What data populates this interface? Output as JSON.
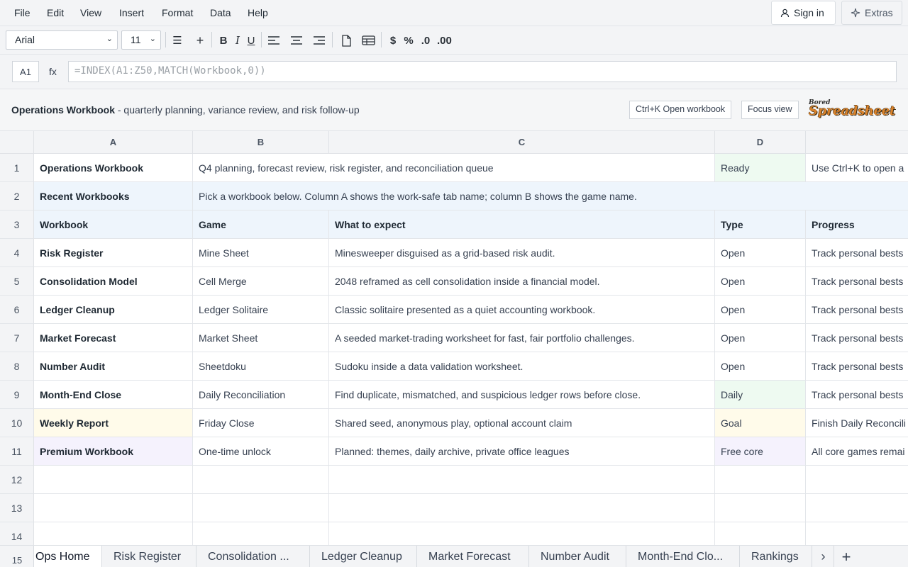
{
  "menu": [
    "File",
    "Edit",
    "View",
    "Insert",
    "Format",
    "Data",
    "Help"
  ],
  "top_buttons": {
    "sign_in": "Sign in",
    "extras": "Extras"
  },
  "toolbar": {
    "font_family": "Arial",
    "font_size": "11",
    "buttons": [
      "☰",
      "+",
      "B",
      "I",
      "U",
      "$",
      "%",
      ".0",
      ".00"
    ]
  },
  "formula_bar": {
    "cell_ref": "A1",
    "fx_label": "fx",
    "formula": "=INDEX(A1:Z50,MATCH(Workbook,0))"
  },
  "title_strip": {
    "title": "Operations Workbook",
    "subtitle": " - quarterly planning, variance review, and risk follow-up",
    "open_button": "Ctrl+K Open workbook",
    "focus_button": "Focus view",
    "logo_small": "Bored",
    "logo_big": "Spreadsheet"
  },
  "columns": [
    "A",
    "B",
    "C",
    "D",
    ""
  ],
  "rows": [
    {
      "num": "1",
      "cells": [
        "Operations Workbook",
        "Q4 planning, forecast review, risk register, and reconciliation queue",
        "",
        "Ready",
        "Use Ctrl+K to open a"
      ]
    },
    {
      "num": "2",
      "cells": [
        "Recent Workbooks",
        "Pick a workbook below. Column A shows the work-safe tab name; column B shows the game name."
      ]
    },
    {
      "num": "3",
      "cells": [
        "Workbook",
        "Game",
        "What to expect",
        "Type",
        "Progress"
      ]
    },
    {
      "num": "4",
      "cells": [
        "Risk Register",
        "Mine Sheet",
        "Minesweeper disguised as a grid-based risk audit.",
        "Open",
        "Track personal bests"
      ]
    },
    {
      "num": "5",
      "cells": [
        "Consolidation Model",
        "Cell Merge",
        "2048 reframed as cell consolidation inside a financial model.",
        "Open",
        "Track personal bests"
      ]
    },
    {
      "num": "6",
      "cells": [
        "Ledger Cleanup",
        "Ledger Solitaire",
        "Classic solitaire presented as a quiet accounting workbook.",
        "Open",
        "Track personal bests"
      ]
    },
    {
      "num": "7",
      "cells": [
        "Market Forecast",
        "Market Sheet",
        "A seeded market-trading worksheet for fast, fair portfolio challenges.",
        "Open",
        "Track personal bests"
      ]
    },
    {
      "num": "8",
      "cells": [
        "Number Audit",
        "Sheetdoku",
        "Sudoku inside a data validation worksheet.",
        "Open",
        "Track personal bests"
      ]
    },
    {
      "num": "9",
      "cells": [
        "Month-End Close",
        "Daily Reconciliation",
        "Find duplicate, mismatched, and suspicious ledger rows before close.",
        "Daily",
        "Track personal bests"
      ]
    },
    {
      "num": "10",
      "cells": [
        "Weekly Report",
        "Friday Close",
        "Shared seed, anonymous play, optional account claim",
        "Goal",
        "Finish Daily Reconcili"
      ]
    },
    {
      "num": "11",
      "cells": [
        "Premium Workbook",
        "One-time unlock",
        "Planned: themes, daily archive, private office leagues",
        "Free core",
        "All core games remai"
      ]
    },
    {
      "num": "12",
      "cells": [
        "",
        "",
        "",
        "",
        ""
      ]
    },
    {
      "num": "13",
      "cells": [
        "",
        "",
        "",
        "",
        ""
      ]
    },
    {
      "num": "14",
      "cells": [
        "",
        "",
        "",
        "",
        ""
      ]
    }
  ],
  "partial_row_number": "15",
  "tabs": [
    "Ops Home",
    "Risk Register",
    "Consolidation ...",
    "Ledger Cleanup",
    "Market Forecast",
    "Number Audit",
    "Month-End Clo...",
    "Rankings"
  ],
  "tab_controls": {
    "next": "›",
    "add": "+"
  },
  "colors": {
    "header_bg": "#f3f4f6",
    "blue_row": "#eef5fc",
    "green_status": "#eefaf1",
    "yellow_goal": "#fffbea",
    "purple_premium": "#f5f2fd",
    "logo_orange": "#d9822b"
  }
}
